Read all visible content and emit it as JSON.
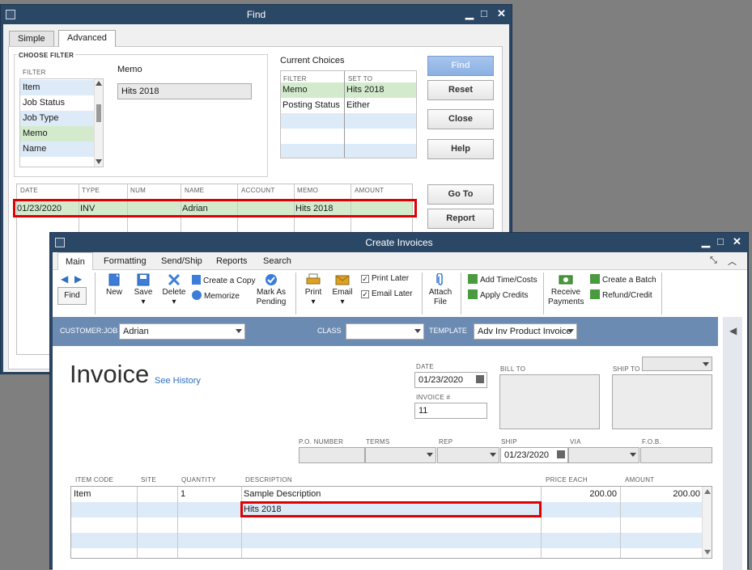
{
  "find_window": {
    "title": "Find",
    "tabs": [
      "Simple",
      "Advanced"
    ],
    "choose_filter_label": "CHOOSE FILTER",
    "filter_header": "FILTER",
    "filter_items": [
      "Item",
      "Job Status",
      "Job Type",
      "Memo",
      "Name"
    ],
    "memo_label": "Memo",
    "memo_value": "Hits 2018",
    "current_choices_label": "Current Choices",
    "choices_headers": [
      "FILTER",
      "SET TO"
    ],
    "choices_rows": [
      {
        "filter": "Memo",
        "set_to": "Hits 2018"
      },
      {
        "filter": "Posting Status",
        "set_to": "Either"
      }
    ],
    "buttons": {
      "find": "Find",
      "reset": "Reset",
      "close": "Close",
      "help": "Help",
      "goto": "Go To",
      "report": "Report"
    },
    "results_headers": [
      "DATE",
      "TYPE",
      "NUM",
      "NAME",
      "ACCOUNT",
      "MEMO",
      "AMOUNT"
    ],
    "results_row": {
      "date": "01/23/2020",
      "type": "INV",
      "num": "",
      "name": "Adrian",
      "account": "",
      "memo": "Hits 2018",
      "amount": ""
    }
  },
  "invoice_window": {
    "title": "Create Invoices",
    "menu_tabs": [
      "Main",
      "Formatting",
      "Send/Ship",
      "Reports",
      "Search"
    ],
    "toolbar": {
      "find": "Find",
      "new": "New",
      "save": "Save",
      "delete": "Delete",
      "create_copy": "Create a Copy",
      "memorize": "Memorize",
      "mark_as": "Mark As",
      "pending": "Pending",
      "print": "Print",
      "email": "Email",
      "print_later": "Print Later",
      "email_later": "Email Later",
      "attach": "Attach",
      "file": "File",
      "add_time_costs": "Add Time/Costs",
      "apply_credits": "Apply Credits",
      "receive": "Receive",
      "payments": "Payments",
      "create_batch": "Create a Batch",
      "refund_credit": "Refund/Credit"
    },
    "header_bar": {
      "customer_job_label": "CUSTOMER:JOB",
      "customer_job_value": "Adrian",
      "class_label": "CLASS",
      "class_value": "",
      "template_label": "TEMPLATE",
      "template_value": "Adv Inv Product Invoice"
    },
    "form": {
      "title": "Invoice",
      "see_history": "See History",
      "date_label": "DATE",
      "date_value": "01/23/2020",
      "invoice_no_label": "INVOICE #",
      "invoice_no_value": "11",
      "bill_to_label": "BILL TO",
      "ship_to_label": "SHIP TO",
      "po_number_label": "P.O. NUMBER",
      "terms_label": "TERMS",
      "rep_label": "REP",
      "ship_label": "SHIP",
      "ship_value": "01/23/2020",
      "via_label": "VIA",
      "fob_label": "F.O.B."
    },
    "line_headers": [
      "ITEM CODE",
      "SITE",
      "QUANTITY",
      "DESCRIPTION",
      "PRICE EACH",
      "AMOUNT"
    ],
    "lines": [
      {
        "item": "Item",
        "site": "",
        "qty": "1",
        "desc": "Sample Description",
        "price": "200.00",
        "amount": "200.00"
      },
      {
        "item": "",
        "site": "",
        "qty": "",
        "desc": "Hits 2018",
        "price": "",
        "amount": ""
      }
    ]
  },
  "colors": {
    "titlebar": "#2b4766",
    "accent_green": "#d3ebcc",
    "accent_blue": "#ddeaf7",
    "highlight_red": "#e00000"
  }
}
